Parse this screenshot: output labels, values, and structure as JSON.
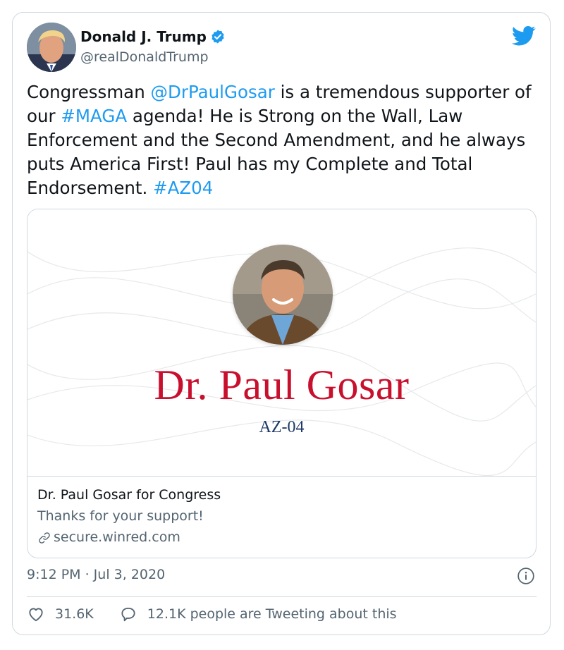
{
  "author": {
    "display_name": "Donald J. Trump",
    "handle": "@realDonaldTrump",
    "verified": true,
    "avatar": "avatar-photo"
  },
  "icons": {
    "verified": "verified-badge-icon",
    "brand": "twitter-bird-icon",
    "link": "link-icon",
    "info": "info-icon",
    "like": "heart-icon",
    "reply": "speech-bubble-icon"
  },
  "tweet": {
    "segments": [
      {
        "text": "Congressman ",
        "type": "text"
      },
      {
        "text": "@DrPaulGosar",
        "type": "mention"
      },
      {
        "text": " is a tremendous supporter of our ",
        "type": "text"
      },
      {
        "text": "#MAGA",
        "type": "hashtag"
      },
      {
        "text": " agenda! He is Strong on the Wall, Law Enforcement and the Second Amendment, and he always puts America First! Paul has my Complete and Total Endorsement. ",
        "type": "text"
      },
      {
        "text": "#AZ04",
        "type": "hashtag"
      }
    ]
  },
  "card": {
    "media_title": "Dr. Paul Gosar",
    "media_subtitle": "AZ-04",
    "title": "Dr. Paul Gosar for Congress",
    "description": "Thanks for your support!",
    "domain": "secure.winred.com"
  },
  "meta": {
    "timestamp": "9:12 PM · Jul 3, 2020"
  },
  "actions": {
    "like_count": "31.6K",
    "tweeting_text": "12.1K people are Tweeting about this"
  },
  "colors": {
    "link": "#1d9bf0",
    "verified": "#1d9bf0",
    "name_red": "#c8102e",
    "subtitle_navy": "#1f3a68",
    "secondary_text": "#536471",
    "border": "#cfd9de"
  }
}
